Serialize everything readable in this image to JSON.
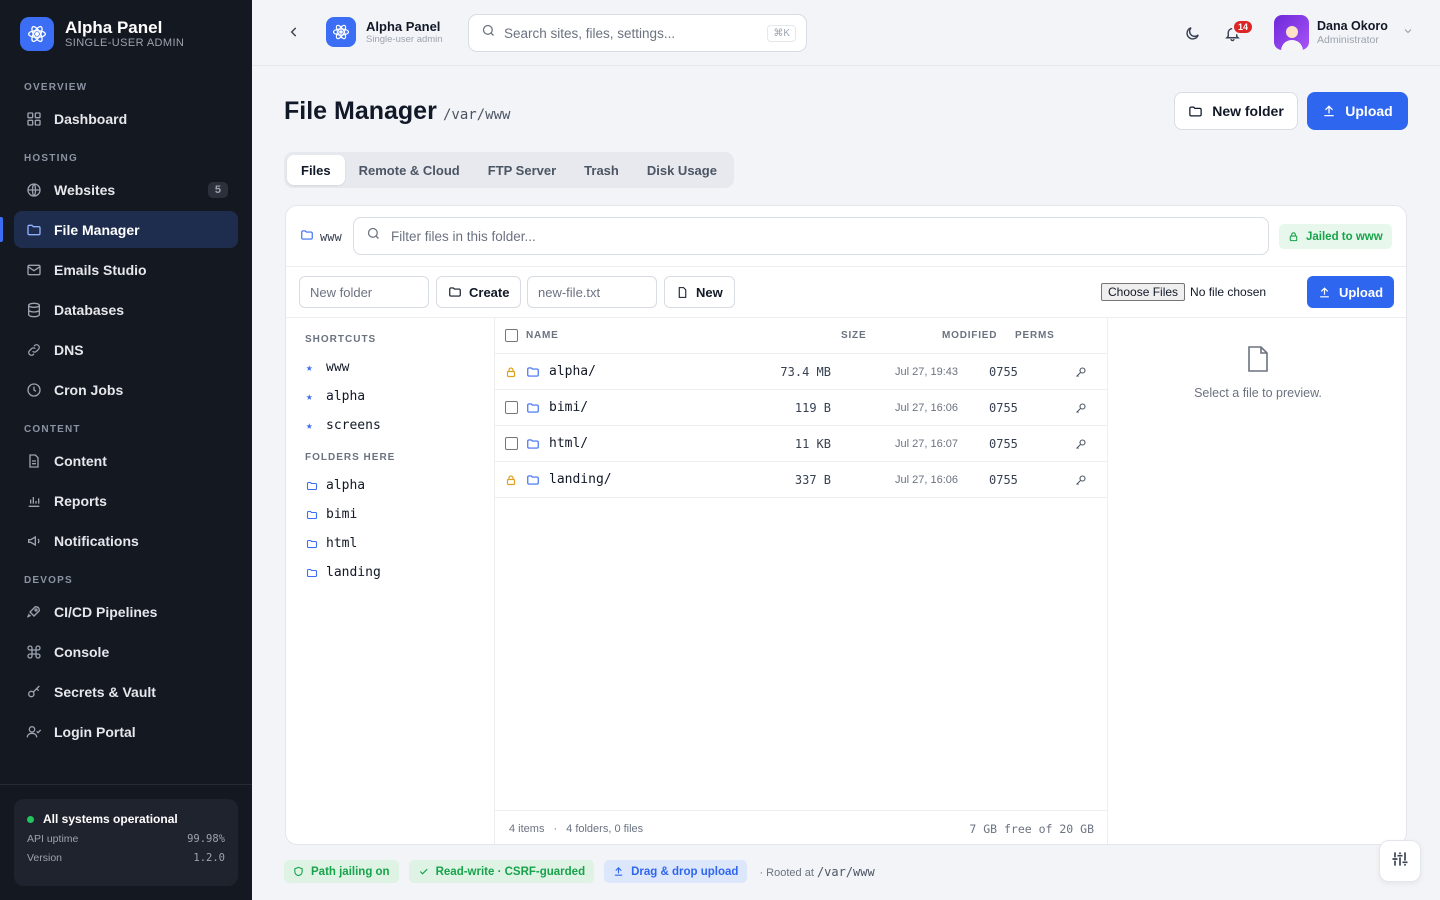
{
  "brand": {
    "title": "Alpha Panel",
    "subtitle": "SINGLE-USER ADMIN"
  },
  "sidebar": {
    "sections": {
      "overview": "OVERVIEW",
      "hosting": "HOSTING",
      "content": "CONTENT",
      "devops": "DEVOPS"
    },
    "items": {
      "dashboard": "Dashboard",
      "websites": "Websites",
      "websites_count": "5",
      "file_manager": "File Manager",
      "emails_studio": "Emails Studio",
      "databases": "Databases",
      "dns": "DNS",
      "cron_jobs": "Cron Jobs",
      "content": "Content",
      "reports": "Reports",
      "notifications": "Notifications",
      "cicd": "CI/CD Pipelines",
      "console": "Console",
      "secrets": "Secrets & Vault",
      "login_portal": "Login Portal"
    },
    "status": {
      "title": "All systems operational",
      "uptime_label": "API uptime",
      "uptime_value": "99.98%",
      "version_label": "Version",
      "version_value": "1.2.0"
    }
  },
  "topbar": {
    "title": "Alpha Panel",
    "subtitle": "Single-user admin",
    "search_placeholder": "Search sites, files, settings...",
    "search_shortcut": "⌘K",
    "notifications_count": "14",
    "user_name": "Dana Okoro",
    "user_role": "Administrator"
  },
  "page": {
    "title": "File Manager",
    "path": "/var/www",
    "new_folder_label": "New folder",
    "upload_label": "Upload"
  },
  "tabs": [
    "Files",
    "Remote & Cloud",
    "FTP Server",
    "Trash",
    "Disk Usage"
  ],
  "toolbar": {
    "crumb": "www",
    "filter_placeholder": "Filter files in this folder...",
    "jail_badge": "Jailed to www",
    "new_folder_placeholder": "New folder",
    "create_label": "Create",
    "new_file_placeholder": "new-file.txt",
    "new_label": "New",
    "choose_files_label": "Choose Files",
    "no_file_label": "No file chosen",
    "upload_label": "Upload"
  },
  "side_panel": {
    "shortcuts_title": "SHORTCUTS",
    "shortcuts": [
      "www",
      "alpha",
      "screens"
    ],
    "folders_title": "FOLDERS HERE",
    "folders": [
      "alpha",
      "bimi",
      "html",
      "landing"
    ]
  },
  "file_list": {
    "columns": {
      "name": "NAME",
      "size": "SIZE",
      "modified": "MODIFIED",
      "perms": "PERMS"
    },
    "rows": [
      {
        "name": "alpha/",
        "size": "73.4 MB",
        "modified": "Jul 27, 19:43",
        "perms": "0755",
        "locked": true
      },
      {
        "name": "bimi/",
        "size": "119 B",
        "modified": "Jul 27, 16:06",
        "perms": "0755",
        "locked": false
      },
      {
        "name": "html/",
        "size": "11 KB",
        "modified": "Jul 27, 16:07",
        "perms": "0755",
        "locked": false
      },
      {
        "name": "landing/",
        "size": "337 B",
        "modified": "Jul 27, 16:06",
        "perms": "0755",
        "locked": true
      }
    ],
    "footer_items": "4 items",
    "footer_sep": "·",
    "footer_counts": "4 folders, 0 files",
    "footer_free": "7 GB free of 20 GB"
  },
  "preview": {
    "placeholder": "Select a file to preview."
  },
  "footer": {
    "chip_jailing": "Path jailing on",
    "chip_rw": "Read-write · CSRF-guarded",
    "chip_dnd": "Drag & drop upload",
    "rooted_prefix": "· Rooted at",
    "rooted_path": "/var/www"
  },
  "colors": {
    "accent": "#2f66f0",
    "sidebar_bg": "#141821",
    "success": "#16a34a",
    "warning": "#e0a020"
  }
}
